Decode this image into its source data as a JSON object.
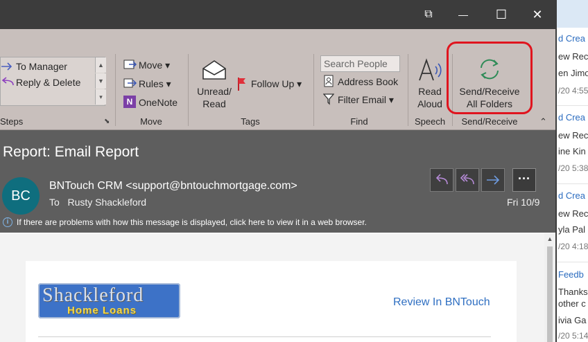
{
  "background_list": {
    "items": [
      {
        "title": "d Crea",
        "line1": "ew Rec",
        "line2": "en Jimo",
        "date": "/20 4:55"
      },
      {
        "title": "d Crea",
        "line1": "ew Rec",
        "line2": "ine Kin",
        "date": "/20 5:38"
      },
      {
        "title": "d Crea",
        "line1": "ew Rec",
        "line2": "yla Pal",
        "date": "/20 4:18"
      },
      {
        "title": "Feedb",
        "line1": "Thanks",
        "line2": "other c",
        "line3": "ivia Ga",
        "date": "/20 5:14"
      }
    ]
  },
  "window": {
    "buttons": {
      "restore": "⧉",
      "minimize": "—",
      "maximize": "☐",
      "close": "✕"
    }
  },
  "ribbon": {
    "quick_steps": {
      "items": [
        "To Manager",
        "Reply & Delete"
      ],
      "label": "Steps"
    },
    "move": {
      "move": "Move",
      "rules": "Rules",
      "onenote": "OneNote",
      "label": "Move"
    },
    "tags": {
      "unread_read_1": "Unread/",
      "unread_read_2": "Read",
      "follow_up": "Follow Up",
      "label": "Tags"
    },
    "find": {
      "search_placeholder": "Search People",
      "address_book": "Address Book",
      "filter_email": "Filter Email",
      "label": "Find"
    },
    "speech": {
      "read_aloud_1": "Read",
      "read_aloud_2": "Aloud",
      "label": "Speech"
    },
    "send_receive": {
      "button_1": "Send/Receive",
      "button_2": "All Folders",
      "label": "Send/Receive"
    },
    "accent_highlight": "#e0141e"
  },
  "message": {
    "subject": "Report: Email Report",
    "avatar_initials": "BC",
    "sender": "BNTouch CRM <support@bntouchmortgage.com>",
    "to_label": "To",
    "to_name": "Rusty Shackleford",
    "date": "Fri 10/9",
    "more": "···",
    "info_text": "If there are problems with how this message is displayed, click here to view it in a web browser."
  },
  "email_body": {
    "logo_main": "Shackleford",
    "logo_sub": "Home Loans",
    "review_link": "Review In BNTouch"
  }
}
